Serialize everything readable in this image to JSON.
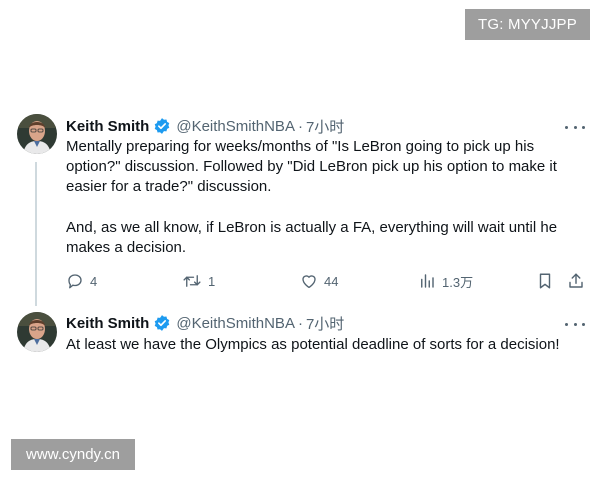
{
  "watermarks": {
    "top": "TG: MYYJJPP",
    "bottom": "www.cyndy.cn"
  },
  "tweets": [
    {
      "author_name": "Keith Smith",
      "handle": "@KeithSmithNBA",
      "separator": "·",
      "time": "7小时",
      "verified_icon": "verified-badge-icon",
      "text_paragraph_1": "Mentally preparing for weeks/months of \"Is LeBron going to pick up his option?\" discussion. Followed by \"Did LeBron pick up his option to make it easier for a trade?\" discussion.",
      "text_paragraph_2": "And, as we all know, if LeBron is actually a FA, everything will wait until he makes a decision.",
      "actions": {
        "reply_count": "4",
        "retweet_count": "1",
        "like_count": "44",
        "views_count": "1.3万"
      }
    },
    {
      "author_name": "Keith Smith",
      "handle": "@KeithSmithNBA",
      "separator": "·",
      "time": "7小时",
      "verified_icon": "verified-badge-icon",
      "text": "At least we have the Olympics as potential deadline of sorts for a decision!"
    }
  ],
  "colors": {
    "text_primary": "#0f1419",
    "text_secondary": "#536471",
    "verified_blue": "#1d9bf0",
    "thread_line": "#cfd9de",
    "watermark_bg": "#9e9e9e"
  }
}
